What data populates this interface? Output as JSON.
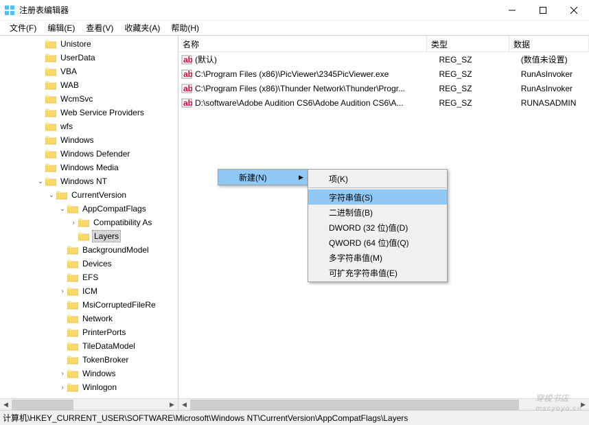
{
  "window": {
    "title": "注册表编辑器"
  },
  "menu": {
    "file": "文件(F)",
    "edit": "编辑(E)",
    "view": "查看(V)",
    "fav": "收藏夹(A)",
    "help": "帮助(H)"
  },
  "tree": [
    {
      "indent": 3,
      "twisty": "",
      "label": "Unistore"
    },
    {
      "indent": 3,
      "twisty": "",
      "label": "UserData"
    },
    {
      "indent": 3,
      "twisty": "",
      "label": "VBA"
    },
    {
      "indent": 3,
      "twisty": "",
      "label": "WAB"
    },
    {
      "indent": 3,
      "twisty": "",
      "label": "WcmSvc"
    },
    {
      "indent": 3,
      "twisty": "",
      "label": "Web Service Providers"
    },
    {
      "indent": 3,
      "twisty": "",
      "label": "wfs"
    },
    {
      "indent": 3,
      "twisty": "",
      "label": "Windows"
    },
    {
      "indent": 3,
      "twisty": "",
      "label": "Windows Defender"
    },
    {
      "indent": 3,
      "twisty": "",
      "label": "Windows Media"
    },
    {
      "indent": 3,
      "twisty": "v",
      "label": "Windows NT"
    },
    {
      "indent": 4,
      "twisty": "v",
      "label": "CurrentVersion"
    },
    {
      "indent": 5,
      "twisty": "v",
      "label": "AppCompatFlags"
    },
    {
      "indent": 6,
      "twisty": ">",
      "label": "Compatibility As"
    },
    {
      "indent": 6,
      "twisty": "",
      "label": "Layers",
      "selected": true
    },
    {
      "indent": 5,
      "twisty": "",
      "label": "BackgroundModel"
    },
    {
      "indent": 5,
      "twisty": "",
      "label": "Devices"
    },
    {
      "indent": 5,
      "twisty": "",
      "label": "EFS"
    },
    {
      "indent": 5,
      "twisty": ">",
      "label": "ICM"
    },
    {
      "indent": 5,
      "twisty": "",
      "label": "MsiCorruptedFileRe"
    },
    {
      "indent": 5,
      "twisty": "",
      "label": "Network"
    },
    {
      "indent": 5,
      "twisty": "",
      "label": "PrinterPorts"
    },
    {
      "indent": 5,
      "twisty": "",
      "label": "TileDataModel"
    },
    {
      "indent": 5,
      "twisty": "",
      "label": "TokenBroker"
    },
    {
      "indent": 5,
      "twisty": ">",
      "label": "Windows"
    },
    {
      "indent": 5,
      "twisty": ">",
      "label": "Winlogon"
    }
  ],
  "columns": {
    "name": "名称",
    "type": "类型",
    "data": "数据"
  },
  "values": [
    {
      "name": "(默认)",
      "type": "REG_SZ",
      "data": "(数值未设置)"
    },
    {
      "name": "C:\\Program Files (x86)\\PicViewer\\2345PicViewer.exe",
      "type": "REG_SZ",
      "data": "RunAsInvoker"
    },
    {
      "name": "C:\\Program Files (x86)\\Thunder Network\\Thunder\\Progr...",
      "type": "REG_SZ",
      "data": "RunAsInvoker"
    },
    {
      "name": "D:\\software\\Adobe Audition CS6\\Adobe Audition CS6\\A...",
      "type": "REG_SZ",
      "data": "RUNASADMIN"
    }
  ],
  "ctx": {
    "new": "新建(N)"
  },
  "submenu": {
    "key": "项(K)",
    "string": "字符串值(S)",
    "binary": "二进制值(B)",
    "dword": "DWORD (32 位)值(D)",
    "qword": "QWORD (64 位)值(Q)",
    "multi": "多字符串值(M)",
    "expand": "可扩充字符串值(E)"
  },
  "status": "计算机\\HKEY_CURRENT_USER\\SOFTWARE\\Microsoft\\Windows NT\\CurrentVersion\\AppCompatFlags\\Layers",
  "watermark": {
    "main": "穿梭书店",
    "sub": "macyoyo.cn"
  }
}
